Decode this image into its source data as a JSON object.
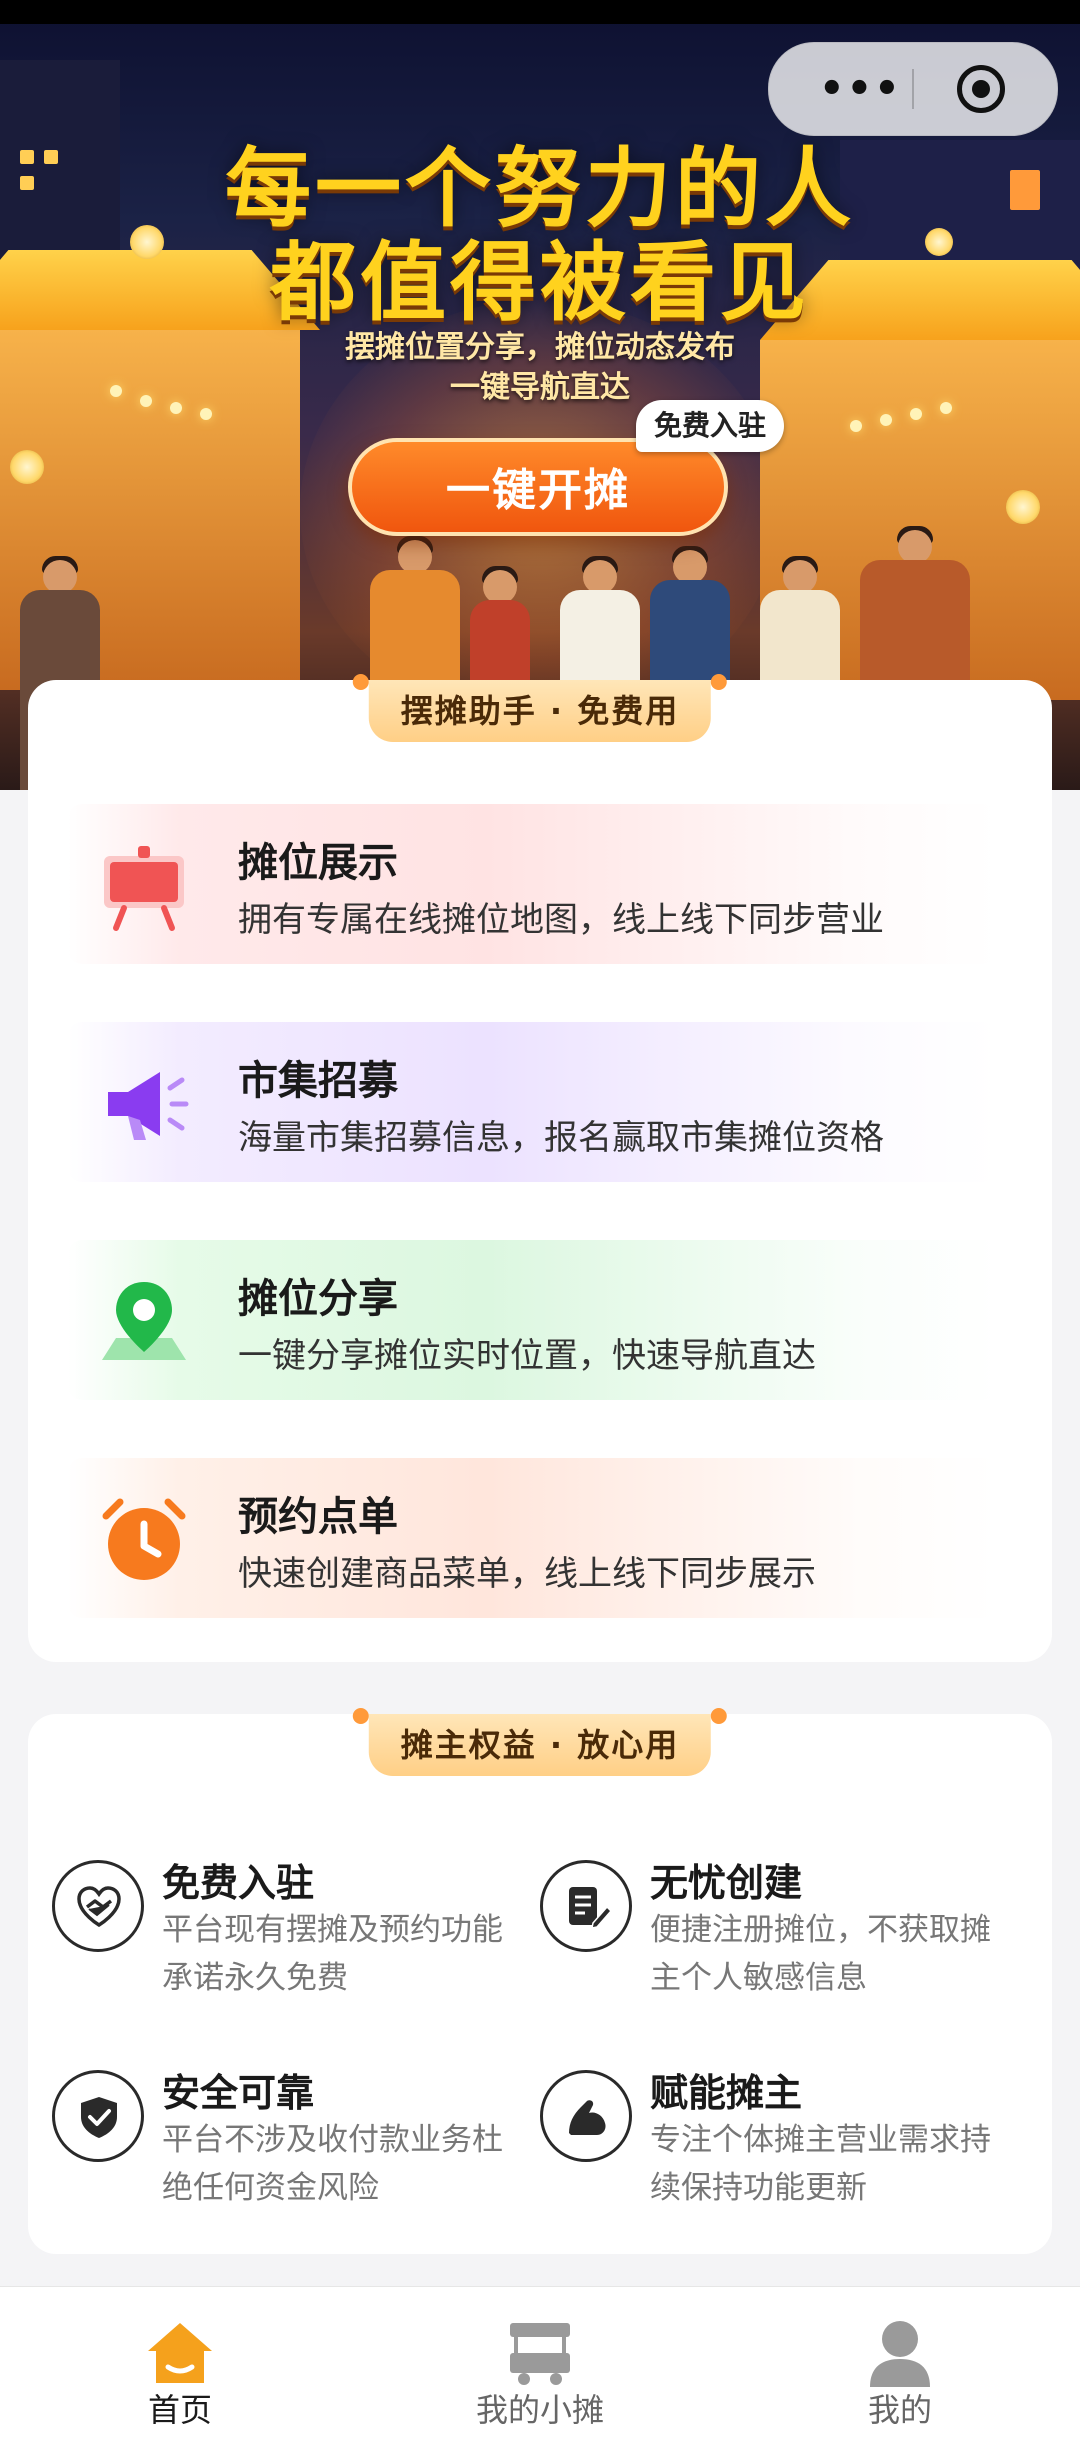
{
  "banner": {
    "headline_1": "每一个努力的人",
    "headline_2": "都值得被看见",
    "sub_1": "摆摊位置分享，摊位动态发布",
    "sub_2": "一键导航直达",
    "cta_label": "一键开摊",
    "cta_badge": "免费入驻"
  },
  "capsule": {
    "more_icon": "more-dots-icon",
    "close_icon": "close-target-icon"
  },
  "features": {
    "header": "摆摊助手 · 免费用",
    "items": [
      {
        "title": "摊位展示",
        "desc": "拥有专属在线摊位地图，线上线下同步营业",
        "icon": "display-board-icon",
        "color": "#f05454"
      },
      {
        "title": "市集招募",
        "desc": "海量市集招募信息，报名赢取市集摊位资格",
        "icon": "megaphone-icon",
        "color": "#8a3cf0"
      },
      {
        "title": "摊位分享",
        "desc": "一键分享摊位实时位置，快速导航直达",
        "icon": "location-pin-icon",
        "color": "#22b84a"
      },
      {
        "title": "预约点单",
        "desc": "快速创建商品菜单，线上线下同步展示",
        "icon": "alarm-clock-icon",
        "color": "#f77a1e"
      }
    ]
  },
  "benefits": {
    "header": "摊主权益 · 放心用",
    "items": [
      {
        "title": "免费入驻",
        "desc": "平台现有摆摊及预约功能承诺永久免费",
        "icon": "heart-handshake-icon"
      },
      {
        "title": "无忧创建",
        "desc": "便捷注册摊位，不获取摊主个人敏感信息",
        "icon": "document-edit-icon"
      },
      {
        "title": "安全可靠",
        "desc": "平台不涉及收付款业务杜绝任何资金风险",
        "icon": "shield-check-icon"
      },
      {
        "title": "赋能摊主",
        "desc": "专注个体摊主营业需求持续保持功能更新",
        "icon": "muscle-arm-icon"
      }
    ]
  },
  "tabbar": {
    "items": [
      {
        "label": "首页",
        "icon": "home-icon",
        "active": true,
        "color": "#f5a11c"
      },
      {
        "label": "我的小摊",
        "icon": "food-cart-icon",
        "active": false,
        "color": "#9a9a9a"
      },
      {
        "label": "我的",
        "icon": "user-icon",
        "active": false,
        "color": "#9a9a9a"
      }
    ]
  }
}
